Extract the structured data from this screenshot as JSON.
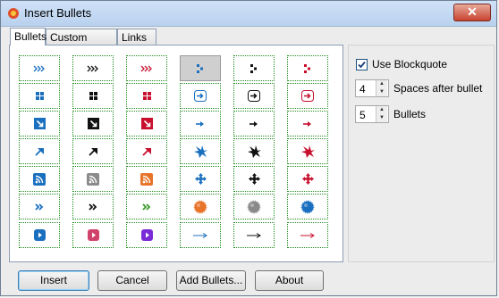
{
  "window": {
    "title": "Insert Bullets",
    "close_label": "✕"
  },
  "tabs": [
    {
      "label": "Bullets",
      "active": true
    },
    {
      "label": "Custom Bullets",
      "active": false
    },
    {
      "label": "Links",
      "active": false
    }
  ],
  "colors": {
    "blue": "#1a6fbf",
    "black": "#111111",
    "red": "#c8102e",
    "grid_border": "#1e8a1e"
  },
  "bullet_grid": [
    [
      "triple-chevron-blue",
      "triple-chevron-black",
      "triple-chevron-red",
      "square-pattern-blue",
      "square-pattern-black",
      "square-pattern-red"
    ],
    [
      "four-squares-blue",
      "four-squares-black",
      "four-squares-red",
      "boxed-arrow-blue",
      "boxed-arrow-black",
      "boxed-arrow-red"
    ],
    [
      "boxed-diagonal-arrow-blue",
      "boxed-diagonal-arrow-black",
      "boxed-diagonal-arrow-red",
      "small-arrow-blue",
      "small-arrow-black",
      "small-arrow-red"
    ],
    [
      "diagonal-arrow-blue",
      "diagonal-arrow-black",
      "diagonal-arrow-red",
      "splat-blue",
      "splat-black",
      "splat-red"
    ],
    [
      "rss-blue",
      "rss-gray",
      "rss-orange",
      "move-cross-blue",
      "move-cross-black",
      "move-cross-red"
    ],
    [
      "double-chevron-blue",
      "double-chevron-black",
      "double-chevron-green",
      "orb-orange",
      "orb-gray",
      "orb-blue"
    ],
    [
      "play-button-blue",
      "play-button-pink",
      "play-button-purple",
      "long-arrow-blue",
      "long-arrow-black",
      "long-arrow-red"
    ]
  ],
  "selected_bullet": "square-pattern-blue",
  "options": {
    "use_blockquote_label": "Use Blockquote",
    "use_blockquote_checked": true,
    "spaces_value": "4",
    "spaces_label": "Spaces after bullet",
    "bullets_value": "5",
    "bullets_label": "Bullets"
  },
  "buttons": {
    "insert": "Insert",
    "cancel": "Cancel",
    "add_bullets": "Add Bullets...",
    "about": "About"
  }
}
